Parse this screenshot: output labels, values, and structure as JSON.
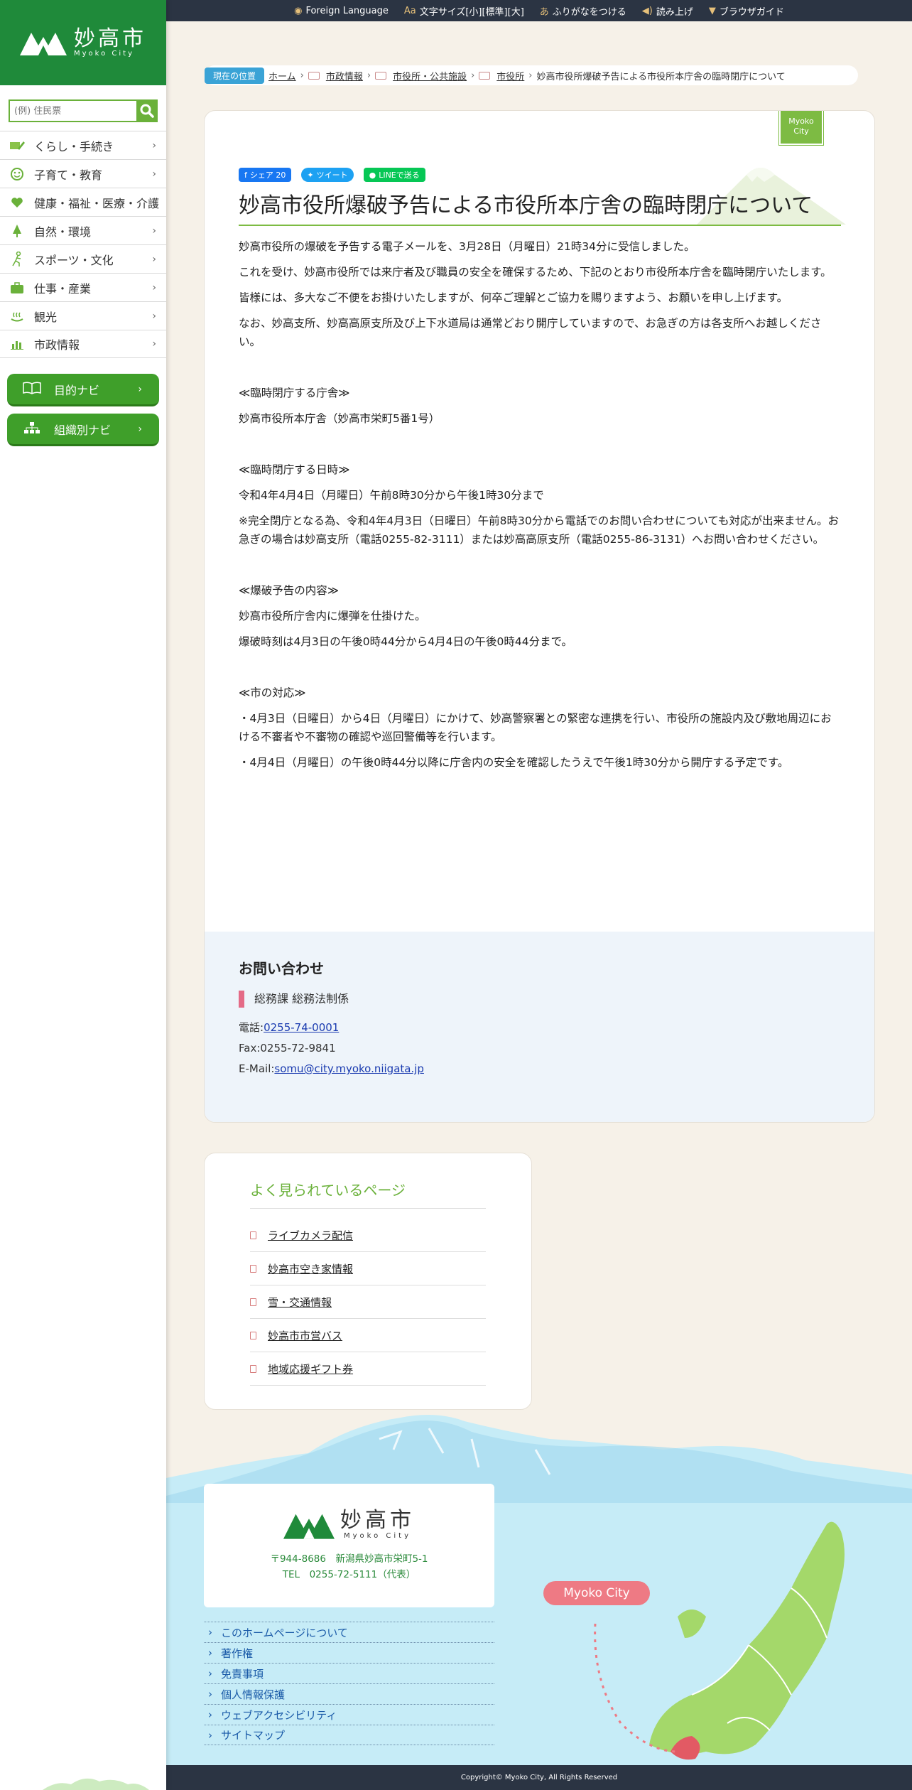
{
  "site": {
    "logo_kanji": "妙高市",
    "logo_roman": "Myoko City"
  },
  "search": {
    "placeholder": "(例) 住民票"
  },
  "sidebar": {
    "items": [
      {
        "label": "くらし・手続き",
        "icon": "pencil-icon"
      },
      {
        "label": "子育て・教育",
        "icon": "smile-face-icon"
      },
      {
        "label": "健康・福祉・医療・介護",
        "icon": "heart-icon"
      },
      {
        "label": "自然・環境",
        "icon": "tree-icon"
      },
      {
        "label": "スポーツ・文化",
        "icon": "running-person-icon"
      },
      {
        "label": "仕事・産業",
        "icon": "briefcase-icon"
      },
      {
        "label": "観光",
        "icon": "hot-spring-icon"
      },
      {
        "label": "市政情報",
        "icon": "bar-chart-icon"
      }
    ],
    "navi_buttons": [
      {
        "label": "目的ナビ",
        "icon": "book-icon"
      },
      {
        "label": "組織別ナビ",
        "icon": "org-chart-icon"
      }
    ]
  },
  "topbar": {
    "foreign": "Foreign Language",
    "fontsize": "文字サイズ[小][標準][大]",
    "furigana": "ふりがなをつける",
    "read": "読み上げ",
    "guide": "ブラウザガイド"
  },
  "breadcrumb": {
    "here": "現在の位置",
    "home": "ホーム",
    "c1": "市政情報",
    "c2": "市役所・公共施設",
    "c3": "市役所",
    "current": "妙高市役所爆破予告による市役所本庁舎の臨時閉庁について"
  },
  "badge": {
    "line1": "Myoko",
    "line2": "City"
  },
  "share": {
    "facebook": "シェア 20",
    "twitter": "ツイート",
    "line": "LINEで送る"
  },
  "article": {
    "title": "妙高市役所爆破予告による市役所本庁舎の臨時閉庁について",
    "p1": "妙高市役所の爆破を予告する電子メールを、3月28日（月曜日）21時34分に受信しました。",
    "p2": "これを受け、妙高市役所では来庁者及び職員の安全を確保するため、下記のとおり市役所本庁舎を臨時閉庁いたします。",
    "p3": "皆様には、多大なご不便をお掛けいたしますが、何卒ご理解とご協力を賜りますよう、お願いを申し上げます。",
    "p4": "なお、妙高支所、妙高高原支所及び上下水道局は通常どおり開庁していますので、お急ぎの方は各支所へお越しください。",
    "h_office": "≪臨時閉庁する庁舎≫",
    "office": "妙高市役所本庁舎（妙高市栄町5番1号）",
    "h_date": "≪臨時閉庁する日時≫",
    "date": "令和4年4月4日（月曜日）午前8時30分から午後1時30分まで",
    "date_note": "※完全閉庁となる為、令和4年4月3日（日曜日）午前8時30分から電話でのお問い合わせについても対応が出来ません。お急ぎの場合は妙高支所（電話0255-82-3111）または妙高高原支所（電話0255-86-3131）へお問い合わせください。",
    "h_content": "≪爆破予告の内容≫",
    "content1": "妙高市役所庁舎内に爆弾を仕掛けた。",
    "content2": "爆破時刻は4月3日の午後0時44分から4月4日の午後0時44分まで。",
    "h_response": "≪市の対応≫",
    "response1": "・4月3日（日曜日）から4日（月曜日）にかけて、妙高警察署との緊密な連携を行い、市役所の施設内及び敷地周辺における不審者や不審物の確認や巡回警備等を行います。",
    "response2": "・4月4日（月曜日）の午後0時44分以降に庁舎内の安全を確認したうえで午後1時30分から開庁する予定です。"
  },
  "contact": {
    "heading": "お問い合わせ",
    "dept": "総務課 総務法制係",
    "tel_label": "電話:",
    "tel": "0255-74-0001",
    "fax": "Fax:0255-72-9841",
    "email_label": "E-Mail:",
    "email": "somu@city.myoko.niigata.jp"
  },
  "popular": {
    "heading": "よく見られているページ",
    "items": [
      "ライブカメラ配信",
      "妙高市空き家情報",
      "雪・交通情報",
      "妙高市市営バス",
      "地域応援ギフト券"
    ]
  },
  "footer": {
    "logo_kanji": "妙高市",
    "logo_roman": "Myoko City",
    "address": "〒944-8686　新潟県妙高市栄町5-1",
    "tel": "TEL　0255-72-5111（代表）",
    "links": [
      "このホームページについて",
      "著作権",
      "免責事項",
      "個人情報保護",
      "ウェブアクセシビリティ",
      "サイトマップ"
    ],
    "map_label": "Myoko City",
    "copyright": "Copyright© Myoko City, All Rights Reserved"
  },
  "colors": {
    "brand_green": "#1f8a3a",
    "accent_green": "#6ab13a",
    "topbar": "#2b3443",
    "sky": "#c6ecf7",
    "pink": "#ee7a84"
  }
}
